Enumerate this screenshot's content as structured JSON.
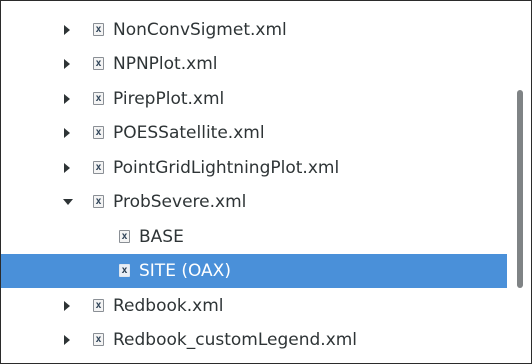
{
  "tree": {
    "items": [
      {
        "label": "NonConvSigmet.xml",
        "icon": "xml-file-icon",
        "icon_glyph": "x",
        "expander": "collapsed"
      },
      {
        "label": "NPNPlot.xml",
        "icon": "xml-file-icon",
        "icon_glyph": "x",
        "expander": "collapsed"
      },
      {
        "label": "PirepPlot.xml",
        "icon": "xml-file-icon",
        "icon_glyph": "x",
        "expander": "collapsed"
      },
      {
        "label": "POESSatellite.xml",
        "icon": "xml-file-icon",
        "icon_glyph": "x",
        "expander": "collapsed"
      },
      {
        "label": "PointGridLightningPlot.xml",
        "icon": "xml-file-icon",
        "icon_glyph": "x",
        "expander": "collapsed"
      },
      {
        "label": "ProbSevere.xml",
        "icon": "xml-file-icon",
        "icon_glyph": "x",
        "expander": "expanded"
      },
      {
        "label": "BASE",
        "icon": "xml-file-icon",
        "icon_glyph": "x",
        "expander": "none"
      },
      {
        "label": "SITE (OAX)",
        "icon": "xml-file-icon",
        "icon_glyph": "x",
        "expander": "none",
        "selected": true
      },
      {
        "label": "Redbook.xml",
        "icon": "xml-file-icon",
        "icon_glyph": "x",
        "expander": "collapsed"
      },
      {
        "label": "Redbook_customLegend.xml",
        "icon": "xml-file-icon",
        "icon_glyph": "x",
        "expander": "collapsed"
      }
    ]
  },
  "colors": {
    "selection": "#4a90d9",
    "selection_text": "#ffffff",
    "text": "#2e3436",
    "scrollbar_thumb": "#7f8385"
  }
}
